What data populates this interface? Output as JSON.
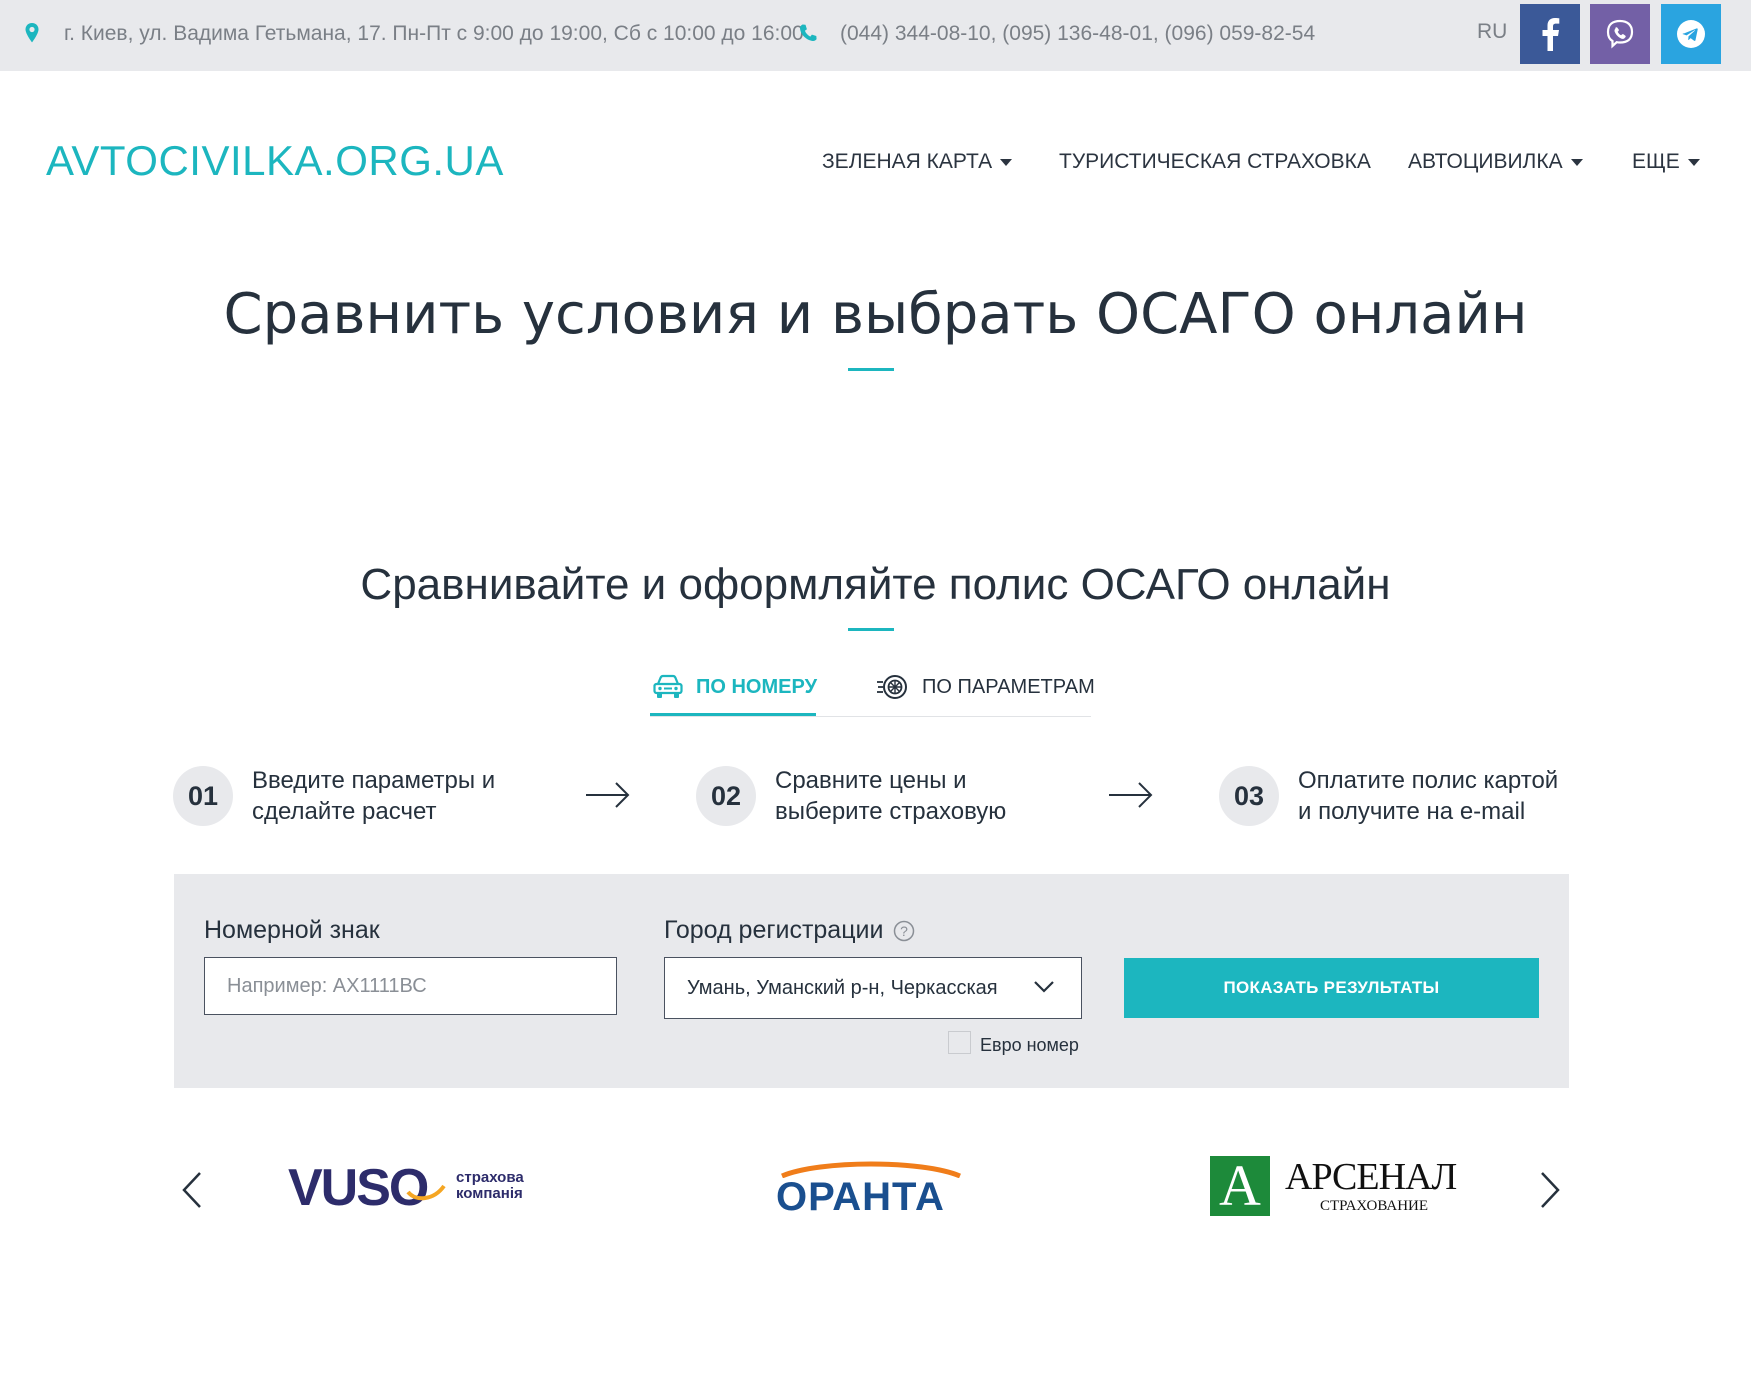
{
  "topbar": {
    "address": "г. Киев, ул. Вадима Гетьмана, 17. Пн-Пт с 9:00 до 19:00, Сб с 10:00 до 16:00",
    "phones": "(044) 344-08-10, (095) 136-48-01, (096) 059-82-54",
    "language": "RU",
    "social": [
      {
        "name": "facebook",
        "icon": "facebook-icon",
        "color": "#3b5998"
      },
      {
        "name": "viber",
        "icon": "viber-icon",
        "color": "#7360a6"
      },
      {
        "name": "telegram",
        "icon": "telegram-icon",
        "color": "#2aa4e0"
      }
    ]
  },
  "header": {
    "logo": "AVTOCIVILKA.ORG.UA",
    "nav": [
      {
        "label": "ЗЕЛЕНАЯ КАРТА",
        "has_dropdown": true
      },
      {
        "label": "ТУРИСТИЧЕСКАЯ СТРАХОВКА",
        "has_dropdown": false
      },
      {
        "label": "АВТОЦИВИЛКА",
        "has_dropdown": true
      },
      {
        "label": "ЕЩЕ",
        "has_dropdown": true
      }
    ]
  },
  "hero": {
    "title": "Сравнить условия и выбрать ОСАГО онлайн"
  },
  "calculator": {
    "title": "Сравнивайте и оформляйте полис ОСАГО онлайн",
    "tabs": [
      {
        "label": "ПО НОМЕРУ",
        "icon": "car-icon",
        "active": true
      },
      {
        "label": "ПО ПАРАМЕТРАМ",
        "icon": "wheel-icon",
        "active": false
      }
    ],
    "steps": [
      {
        "num": "01",
        "line1": "Введите параметры и",
        "line2": "сделайте расчет"
      },
      {
        "num": "02",
        "line1": "Сравните цены и",
        "line2": "выберите страховую"
      },
      {
        "num": "03",
        "line1": "Оплатите полис картой",
        "line2": "и получите на e-mail"
      }
    ],
    "form": {
      "plate_label": "Номерной знак",
      "plate_placeholder": "Например: АХ1111ВС",
      "plate_value": "",
      "city_label": "Город регистрации",
      "city_value": "Умань, Уманский р-н, Черкасская",
      "submit_label": "ПОКАЗАТЬ РЕЗУЛЬТАТЫ",
      "euro_label": "Евро номер",
      "euro_checked": false
    }
  },
  "partners": {
    "logos": [
      {
        "name": "VUSO",
        "text_main": "VUSO",
        "text_sub1": "страхова",
        "text_sub2": "компанія"
      },
      {
        "name": "ОРАНТА",
        "text_main": "ОРАНТА"
      },
      {
        "name": "АРСЕНАЛ",
        "text_letter": "A",
        "text_main": "АРСЕНАЛ",
        "text_sub": "СТРАХОВАНИЕ"
      }
    ]
  }
}
